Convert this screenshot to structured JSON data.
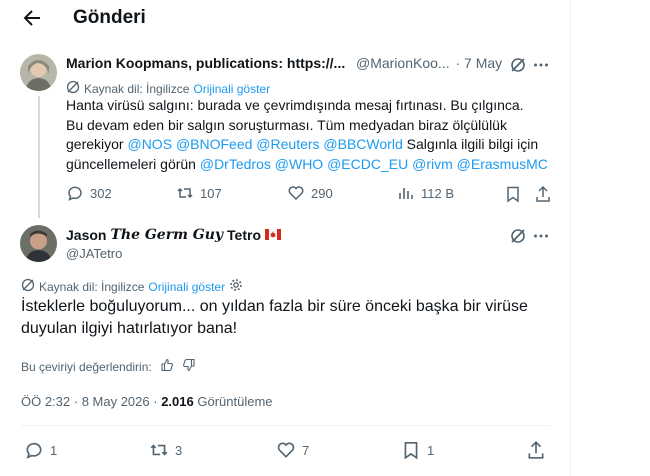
{
  "header": {
    "title": "Gönderi"
  },
  "tweet1": {
    "name": "Marion Koopmans, publications: https://...",
    "handle": "@MarionKoo...",
    "date": "· 7 May",
    "translate_label": "Kaynak dil: İngilizce",
    "show_original": "Orijinali göster",
    "text_line1": "Hanta virüsü salgını: burada ve çevrimdışında mesaj fırtınası. Bu çılgınca.",
    "text_line2": "Bu devam eden bir salgın soruşturması. Tüm medyadan biraz ölçülülük",
    "text_line3_pre": "gerekiyor",
    "mention_nos": "@NOS",
    "mention_bnofeed": "@BNOFeed",
    "mention_reuters": "@Reuters",
    "mention_bbcworld": "@BBCWorld",
    "text_line3_post": "Salgınla ilgili bilgi için",
    "text_line4_pre": "güncellemeleri görün",
    "mention_drtedros": "@DrTedros",
    "mention_who": "@WHO",
    "mention_ecdc": "@ECDC_EU",
    "mention_rivm": "@rivm",
    "mention_erasmus": "@ErasmusMC",
    "replies": "302",
    "reposts": "107",
    "likes": "290",
    "views": "112 B"
  },
  "tweet2": {
    "name_first": "Jason",
    "name_italic": "The Germ Guy",
    "name_last": "Tetro",
    "handle": "@JATetro",
    "translate_label": "Kaynak dil: İngilizce",
    "show_original": "Orijinali göster",
    "text_line1": "İsteklerle boğuluyorum... on yıldan fazla bir süre önceki başka bir virüse",
    "text_line2": "duyulan ilgiyi hatırlatıyor bana!",
    "rate_label": "Bu çeviriyi değerlendirin:",
    "time": "ÖÖ 2:32 · 8 May 2026 ·",
    "views_count": "2.016",
    "views_label": "Görüntüleme",
    "replies": "1",
    "reposts": "3",
    "likes": "7",
    "bookmarks": "1"
  },
  "colors": {
    "accent": "#1d9bf0",
    "secondary_text": "#536471",
    "flag_red": "#d52b1e"
  },
  "icons": [
    "back-arrow-icon",
    "grok-icon",
    "more-icon",
    "translate-icon",
    "reply-icon",
    "repost-icon",
    "like-icon",
    "views-icon",
    "bookmark-icon",
    "share-icon",
    "gear-icon",
    "thumbs-up-icon",
    "thumbs-down-icon",
    "canada-flag-icon"
  ]
}
